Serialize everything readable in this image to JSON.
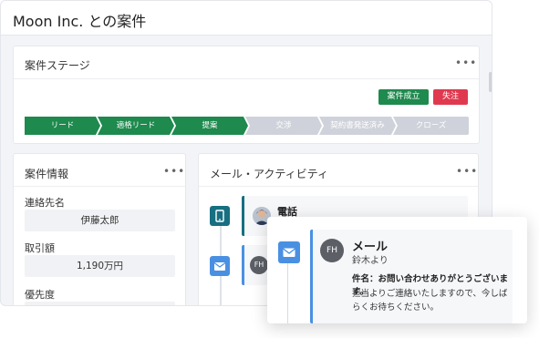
{
  "page": {
    "title": "Moon Inc. との案件"
  },
  "stage_card": {
    "title": "案件ステージ",
    "menu_label": "•••",
    "won_label": "案件成立",
    "lost_label": "失注",
    "stages": [
      {
        "label": "リード",
        "status": "done"
      },
      {
        "label": "適格リード",
        "status": "done"
      },
      {
        "label": "提案",
        "status": "done"
      },
      {
        "label": "交渉",
        "status": "todo"
      },
      {
        "label": "契約書発送済み",
        "status": "todo"
      },
      {
        "label": "クローズ",
        "status": "todo"
      }
    ]
  },
  "info_card": {
    "title": "案件情報",
    "menu_label": "•••",
    "fields": [
      {
        "label": "連絡先名",
        "value": "伊藤太郎"
      },
      {
        "label": "取引額",
        "value": "1,190万円"
      },
      {
        "label": "優先度",
        "value": ""
      }
    ]
  },
  "mail_card": {
    "title": "メール・アクティビティ",
    "menu_label": "•••",
    "activities": [
      {
        "title": "電話",
        "icon": "phone-icon"
      },
      {
        "title": "",
        "icon": "mail-icon",
        "avatar": "FH"
      }
    ]
  },
  "popup": {
    "title": "メール",
    "sender": "鈴木より",
    "avatar": "FH",
    "subject": "件名：お問い合わせありがとうございます。",
    "body": "担当よりご連絡いたしますので、今しばらくお待ちください。"
  },
  "colors": {
    "accent_green": "#1e8a4e",
    "danger_red": "#e0394f",
    "mail_blue": "#4a90e2",
    "phone_teal": "#176f81"
  }
}
